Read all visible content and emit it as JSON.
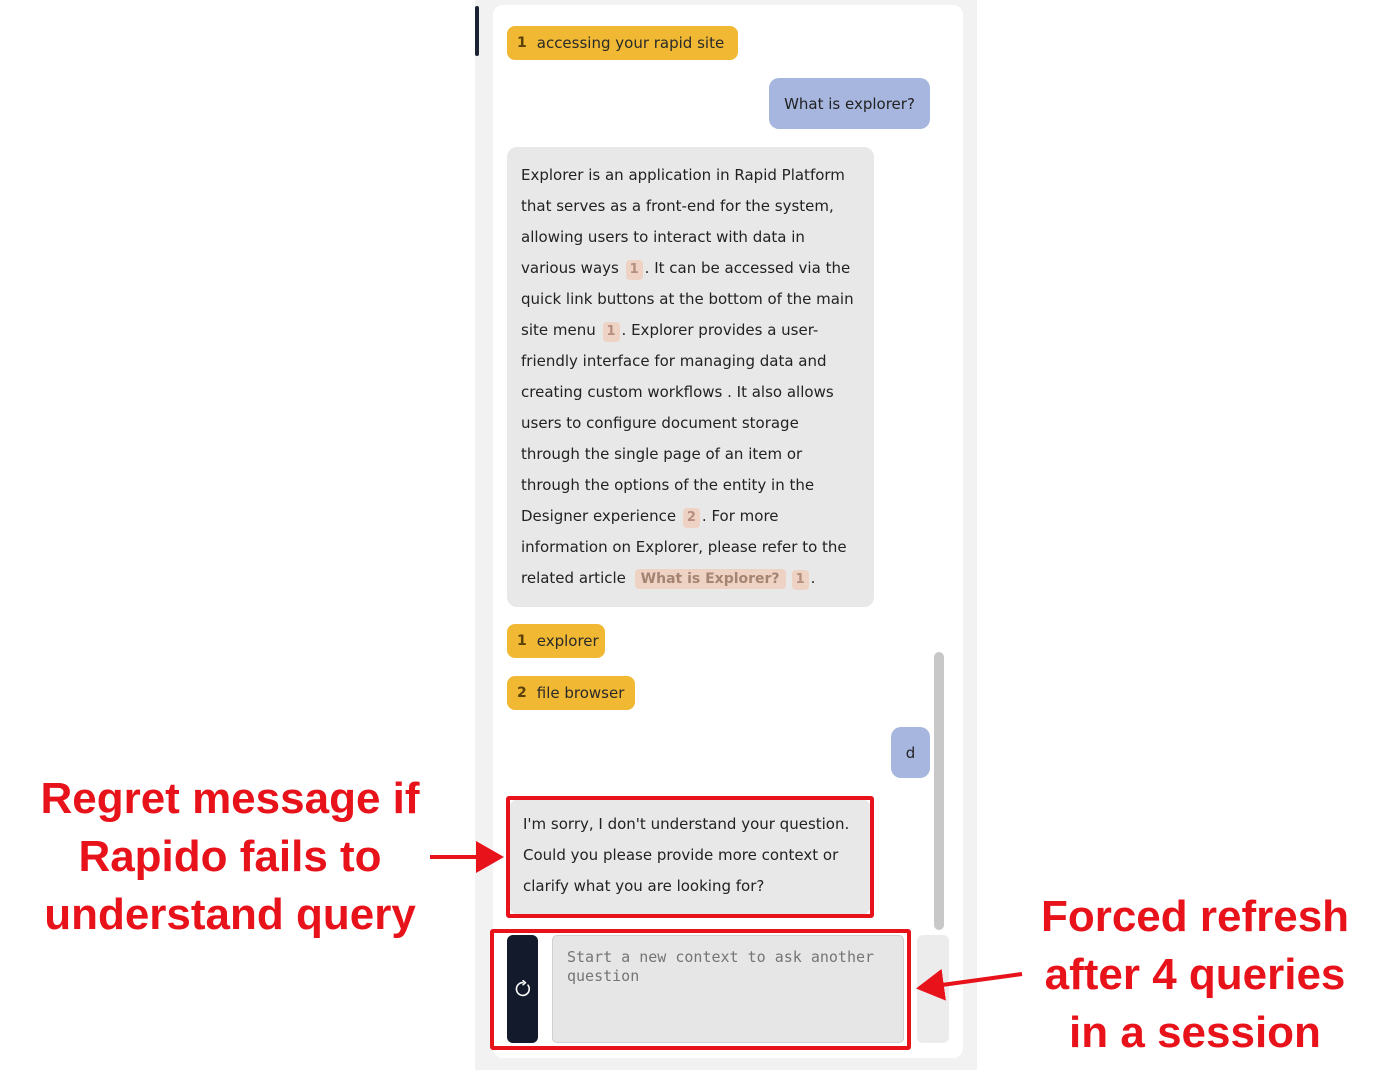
{
  "chat": {
    "top_chip": {
      "num": "1",
      "label": "accessing your rapid site"
    },
    "user_msg_1": "What is explorer?",
    "bot_msg_1": {
      "p1": "Explorer is an application in Rapid Platform that serves as a front-end for the system, allowing users to interact with data in various ways",
      "r1": "1",
      "p2": ". It can be accessed via the quick link buttons at the bottom of the main site menu",
      "r2": "1",
      "p3": ". Explorer provides a user-friendly interface for managing data and creating custom workflows . It also allows users to configure document storage through the single page of an item or through the options of the entity in the Designer experience",
      "r3": "2",
      "p4": ". For more information on Explorer, please refer to the related article",
      "link": "What is Explorer?",
      "r4": "1",
      "p5": "."
    },
    "chips": [
      {
        "num": "1",
        "label": "explorer"
      },
      {
        "num": "2",
        "label": "file browser"
      }
    ],
    "user_msg_2": "d",
    "bot_msg_2": "I'm sorry, I don't understand your question. Could you please provide more context or clarify what you are looking for?",
    "input": {
      "placeholder": "Start a new context to ask another question"
    }
  },
  "annotations": {
    "left": [
      "Regret message if",
      "Rapido fails to",
      "understand query"
    ],
    "right": [
      "Forced refresh",
      "after 4 queries",
      "in a session"
    ]
  },
  "colors": {
    "annotation": "#e8121b",
    "chip": "#f0b833",
    "user_bubble": "#a7b6df",
    "bot_bubble": "#e8e8e8"
  }
}
